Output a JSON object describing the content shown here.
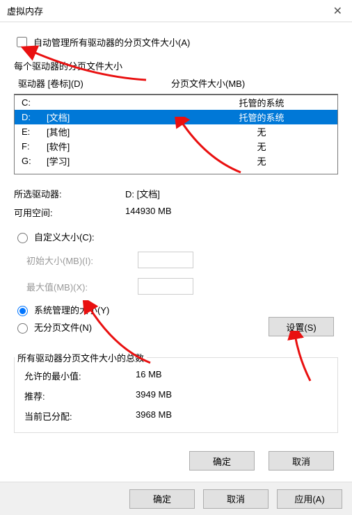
{
  "window": {
    "title": "虚拟内存"
  },
  "auto_manage": {
    "label": "自动管理所有驱动器的分页文件大小(A)"
  },
  "per_drive_label": "每个驱动器的分页文件大小",
  "columns": {
    "drive": "驱动器 [卷标](D)",
    "size": "分页文件大小(MB)"
  },
  "drives": [
    {
      "letter": "C:",
      "volume": "",
      "status": "托管的系统"
    },
    {
      "letter": "D:",
      "volume": "[文档]",
      "status": "托管的系统"
    },
    {
      "letter": "E:",
      "volume": "[其他]",
      "status": "无"
    },
    {
      "letter": "F:",
      "volume": "[软件]",
      "status": "无"
    },
    {
      "letter": "G:",
      "volume": "[学习]",
      "status": "无"
    }
  ],
  "selected_index": 1,
  "selected": {
    "label": "所选驱动器:",
    "value": "D:  [文档]"
  },
  "freespace": {
    "label": "可用空间:",
    "value": "144930 MB"
  },
  "custom": {
    "label": "自定义大小(C):",
    "initial_label": "初始大小(MB)(I):",
    "max_label": "最大值(MB)(X):"
  },
  "system_managed": {
    "label": "系统管理的大小(Y)"
  },
  "no_paging": {
    "label": "无分页文件(N)"
  },
  "set_button": "设置(S)",
  "totals": {
    "title": "所有驱动器分页文件大小的总数",
    "min_label": "允许的最小值:",
    "min_value": "16 MB",
    "rec_label": "推荐:",
    "rec_value": "3949 MB",
    "cur_label": "当前已分配:",
    "cur_value": "3968 MB"
  },
  "inner_buttons": {
    "ok": "确定",
    "cancel": "取消"
  },
  "bottom_buttons": {
    "ok": "确定",
    "cancel": "取消",
    "apply": "应用(A)"
  }
}
